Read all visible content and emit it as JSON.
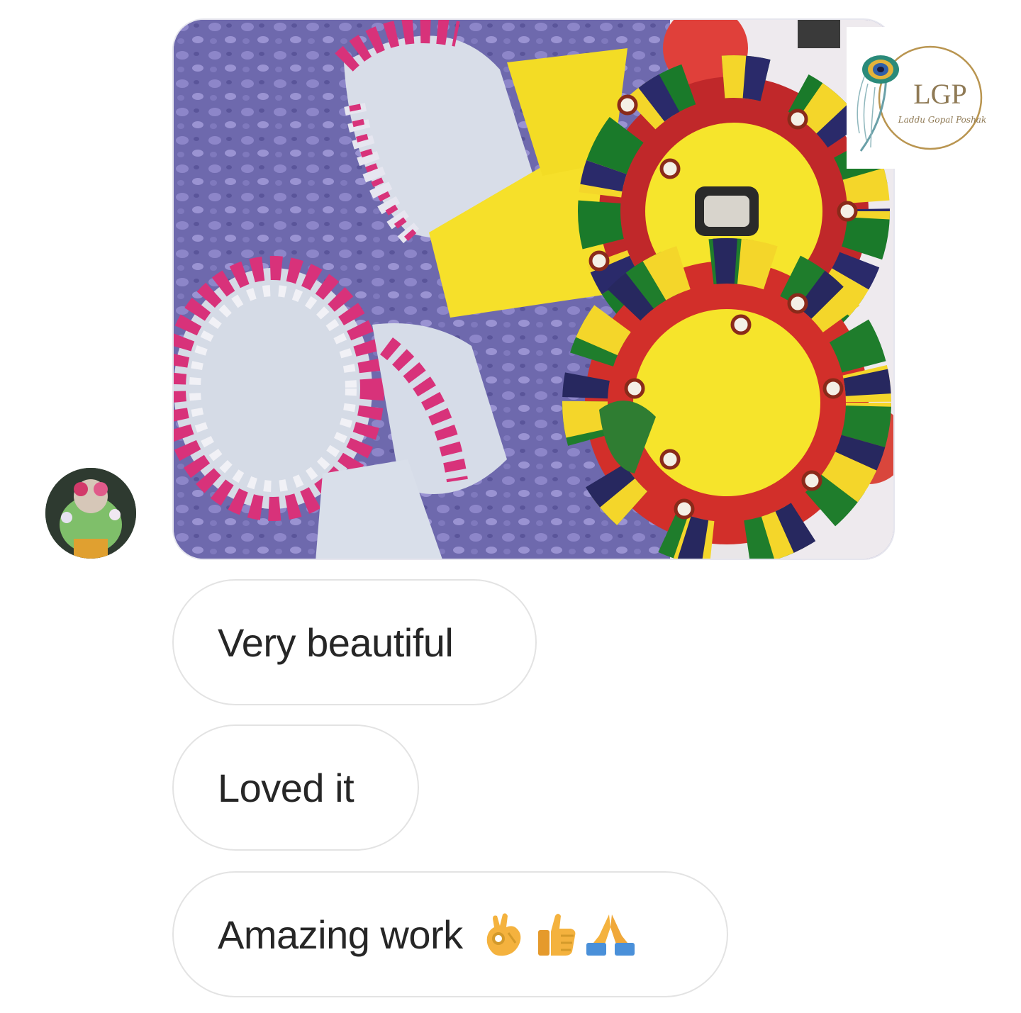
{
  "logo": {
    "monogram": "LGP",
    "script_text": "Laddu Gopal Poshak"
  },
  "messages": [
    {
      "text": "Very beautiful"
    },
    {
      "text": "Loved it"
    },
    {
      "text": "Amazing work",
      "emojis": [
        "ok-hand-emoji",
        "thumbs-up-emoji",
        "folded-hands-emoji"
      ]
    }
  ],
  "colors": {
    "bubble_border": "#e3e3e3",
    "text": "#262626",
    "emoji_yellow": "#f4b23e",
    "emoji_blue": "#4a90d9"
  }
}
